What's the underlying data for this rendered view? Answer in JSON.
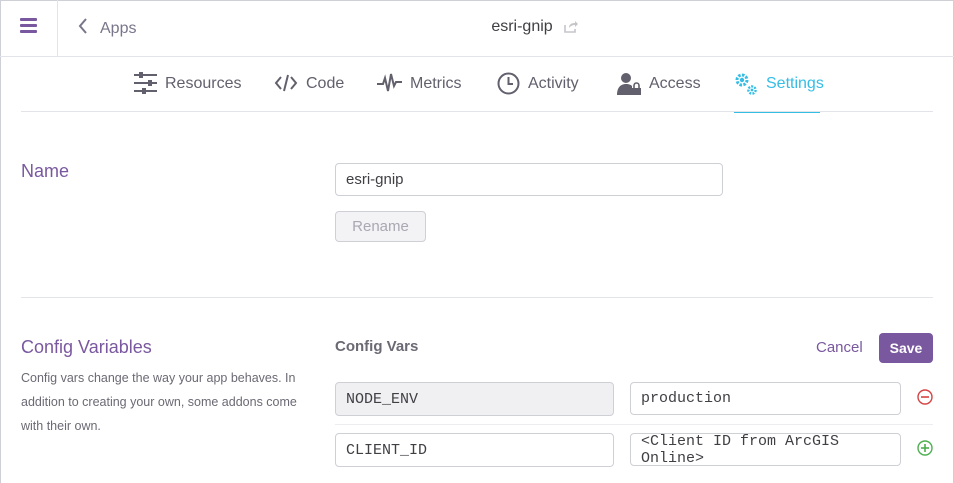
{
  "topbar": {
    "back_label": "Apps",
    "app_name": "esri-gnip"
  },
  "tabs": [
    {
      "label": "Resources",
      "icon": "resources-icon"
    },
    {
      "label": "Code",
      "icon": "code-icon"
    },
    {
      "label": "Metrics",
      "icon": "metrics-icon"
    },
    {
      "label": "Activity",
      "icon": "activity-icon"
    },
    {
      "label": "Access",
      "icon": "access-icon"
    },
    {
      "label": "Settings",
      "icon": "settings-icon",
      "active": true
    }
  ],
  "name_section": {
    "label": "Name",
    "value": "esri-gnip",
    "rename_label": "Rename"
  },
  "config_section": {
    "label": "Config Variables",
    "description": "Config vars change the way your app behaves. In addition to creating your own, some addons come with their own.",
    "header": "Config Vars",
    "cancel_label": "Cancel",
    "save_label": "Save",
    "rows": [
      {
        "key": "NODE_ENV",
        "value": "production"
      },
      {
        "key": "CLIENT_ID",
        "value": "<Client ID from ArcGIS Online>"
      }
    ]
  },
  "colors": {
    "brand_purple": "#79589f",
    "active_tab": "#35bde6",
    "remove_red": "#d64242",
    "add_green": "#4caf50"
  }
}
